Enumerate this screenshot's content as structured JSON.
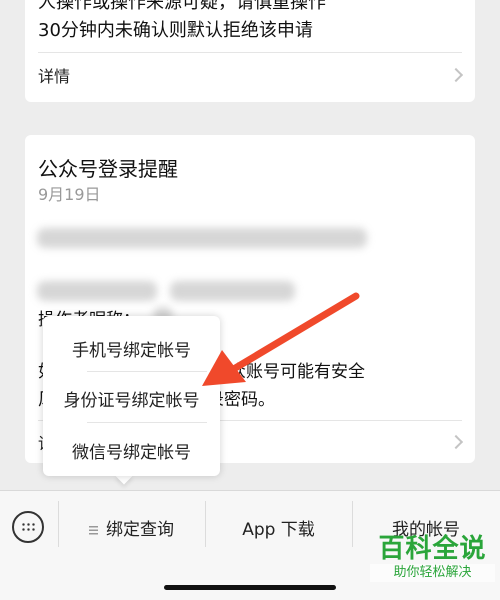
{
  "prev_card": {
    "line1": "人操作或操作来源可疑，请慎重操作",
    "line2": "30分钟内未确认则默认拒绝该申请",
    "detail": "详情"
  },
  "notice_card": {
    "title": "公众号登录提醒",
    "date": "9月19日",
    "operator_label": "操作者昵称：",
    "sentence1_prefix": "如",
    "sentence1_suffix": "的公众账号可能有安全",
    "sentence2_prefix": "风",
    "sentence2_suffix": "录密码。",
    "detail": "详"
  },
  "popup_menu": {
    "items": [
      "手机号绑定帐号",
      "身份证号绑定帐号",
      "微信号绑定帐号"
    ]
  },
  "bottom_menu": {
    "keyboard_icon": "keyboard-icon",
    "items": [
      "绑定查询",
      "App 下载",
      "我的帐号"
    ]
  },
  "watermark": {
    "main": "百科全说",
    "sub": "助你轻松解决"
  },
  "colors": {
    "arrow": "#f0492b",
    "watermark": "#2aa53a",
    "background": "#ededed"
  }
}
